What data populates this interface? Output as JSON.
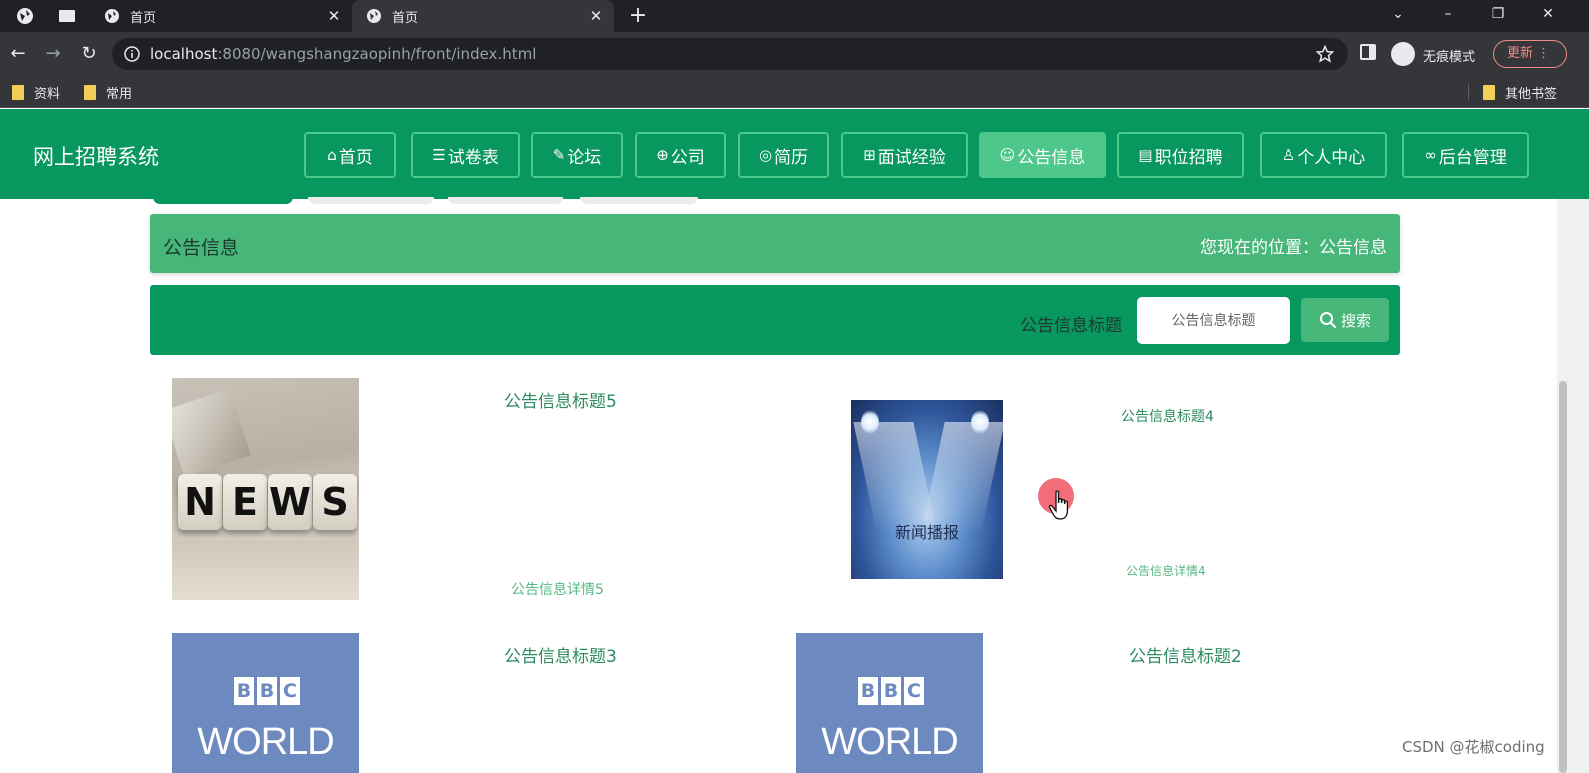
{
  "browser": {
    "tabs": [
      {
        "title": "首页",
        "active": false
      },
      {
        "title": "首页",
        "active": true
      }
    ],
    "url_host": "localhost",
    "url_path": ":8080/wangshangzaopinh/front/index.html",
    "incognito_label": "无痕模式",
    "update_label": "更新",
    "bookmarks": [
      "资料",
      "常用"
    ],
    "other_bookmarks": "其他书签"
  },
  "site": {
    "title": "网上招聘系统",
    "nav": [
      {
        "label": "首页",
        "icon": "home-icon",
        "glyph": "⌂",
        "active": false
      },
      {
        "label": "试卷表",
        "icon": "list-icon",
        "glyph": "☰",
        "active": false
      },
      {
        "label": "论坛",
        "icon": "edit-icon",
        "glyph": "✎",
        "active": false
      },
      {
        "label": "公司",
        "icon": "globe-icon",
        "glyph": "⊕",
        "active": false
      },
      {
        "label": "简历",
        "icon": "palette-icon",
        "glyph": "◎",
        "active": false
      },
      {
        "label": "面试经验",
        "icon": "brackets-icon",
        "glyph": "⊞",
        "active": false
      },
      {
        "label": "公告信息",
        "icon": "smile-icon",
        "glyph": "☺",
        "active": true
      },
      {
        "label": "职位招聘",
        "icon": "document-icon",
        "glyph": "▤",
        "active": false
      },
      {
        "label": "个人中心",
        "icon": "user-icon",
        "glyph": "♙",
        "active": false
      },
      {
        "label": "后台管理",
        "icon": "link-icon",
        "glyph": "∞",
        "active": false
      }
    ]
  },
  "breadcrumb": {
    "title": "公告信息",
    "location": "您现在的位置：公告信息"
  },
  "search": {
    "label": "公告信息标题",
    "placeholder": "公告信息标题",
    "button_label": "搜索"
  },
  "notices": [
    {
      "title": "公告信息标题5",
      "detail": "公告信息详情5",
      "image": "news-dice"
    },
    {
      "title": "公告信息标题4",
      "detail": "公告信息详情4",
      "image": "spotlight",
      "image_text": "新闻播报"
    },
    {
      "title": "公告信息标题3",
      "image": "bbc-world"
    },
    {
      "title": "公告信息标题2",
      "image": "bbc-world"
    }
  ],
  "bbc_logo": {
    "letters": [
      "B",
      "B",
      "C"
    ],
    "world": "WORLD"
  },
  "news_letters": [
    "N",
    "E",
    "W",
    "S"
  ],
  "watermark": "CSDN @花椒coding",
  "colors": {
    "primary": "#08975e",
    "accent": "#46b679",
    "nav_border": "#4cc88a",
    "title_text": "#2b8a60"
  }
}
